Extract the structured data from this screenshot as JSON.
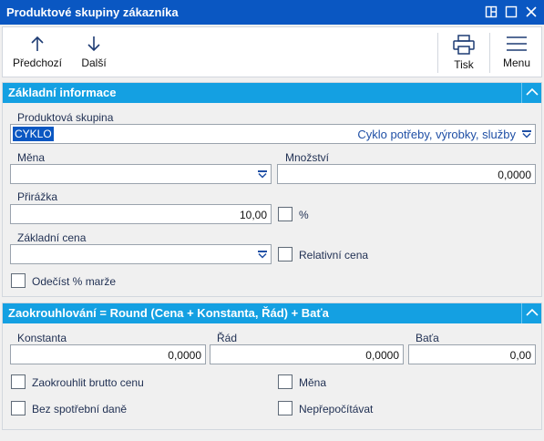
{
  "window": {
    "title": "Produktové skupiny zákazníka"
  },
  "toolbar": {
    "prev_label": "Předchozí",
    "next_label": "Další",
    "print_label": "Tisk",
    "menu_label": "Menu"
  },
  "section_basic": {
    "title": "Základní informace",
    "product_group_label": "Produktová skupina",
    "product_group_code": "CYKLO",
    "product_group_name": "Cyklo potřeby, výrobky, služby",
    "currency_label": "Měna",
    "currency_value": "",
    "quantity_label": "Množství",
    "quantity_value": "0,0000",
    "markup_label": "Přirážka",
    "markup_value": "10,00",
    "percent_label": "%",
    "base_price_label": "Základní cena",
    "base_price_value": "",
    "relative_price_label": "Relativní cena",
    "subtract_margin_label": "Odečíst % marže"
  },
  "section_rounding": {
    "title": "Zaokrouhlování = Round (Cena + Konstanta, Řád) + Baťa",
    "constant_label": "Konstanta",
    "constant_value": "0,0000",
    "order_label": "Řád",
    "order_value": "0,0000",
    "bata_label": "Baťa",
    "bata_value": "0,00",
    "round_gross_label": "Zaokrouhlit brutto cenu",
    "currency_label": "Měna",
    "no_excise_label": "Bez spotřební daně",
    "no_recalc_label": "Nepřepočítávat"
  }
}
